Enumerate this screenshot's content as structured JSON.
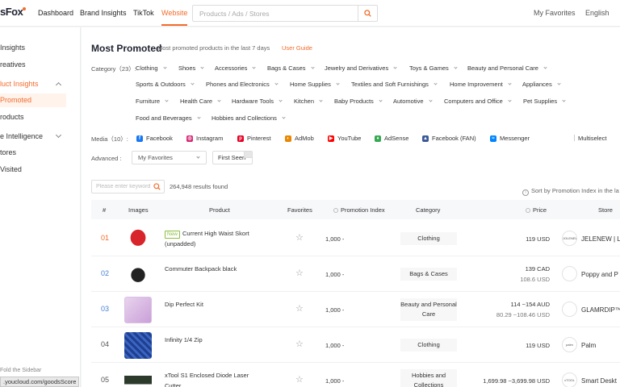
{
  "topnav": {
    "logo": "sFox",
    "items": [
      "Dashboard",
      "Brand Insights",
      "TikTok",
      "Website"
    ],
    "active_index": 3,
    "search_placeholder": "Products / Ads / Stores",
    "favorites": "My Favorites",
    "language": "English"
  },
  "sidebar": {
    "items": [
      "Insights",
      "reatives",
      "luct Insights",
      "Promoted",
      "roducts",
      "e Intelligence",
      "tores",
      "Visited"
    ],
    "fold_label": "Fold the Sidebar",
    "status_url": ".youcloud.com/goodsScore"
  },
  "header": {
    "title": "Most Promoted",
    "subtitle": "Most promoted products in the last 7 days",
    "guide": "User Guide"
  },
  "filters": {
    "category_label": "Category（23）:",
    "categories": [
      "Clothing",
      "Shoes",
      "Accessories",
      "Bags & Cases",
      "Jewelry and Derivatives",
      "Toys & Games",
      "Beauty and Personal Care",
      "Sports & Outdoors",
      "Phones and Electronics",
      "Home Supplies",
      "Textiles and Soft Furnishings",
      "Home Improvement",
      "Appliances",
      "Furniture",
      "Health Care",
      "Hardware Tools",
      "Kitchen",
      "Baby Products",
      "Automotive",
      "Computers and Office",
      "Pet Supplies",
      "Food and Beverages",
      "Hobbies and Collections"
    ],
    "media_label": "Media（10）:",
    "media": [
      {
        "label": "Facebook",
        "icon": "facebook-icon",
        "color": "#1877f2",
        "glyph": "f"
      },
      {
        "label": "Instagram",
        "icon": "instagram-icon",
        "color": "#d62976",
        "glyph": "◎"
      },
      {
        "label": "Pinterest",
        "icon": "pinterest-icon",
        "color": "#e60023",
        "glyph": "p"
      },
      {
        "label": "AdMob",
        "icon": "admob-icon",
        "color": "#ea8600",
        "glyph": "◐"
      },
      {
        "label": "YouTube",
        "icon": "youtube-icon",
        "color": "#ff0000",
        "glyph": "▶"
      },
      {
        "label": "AdSense",
        "icon": "adsense-icon",
        "color": "#34a853",
        "glyph": "♦"
      },
      {
        "label": "Facebook (FAN)",
        "icon": "facebook-fan-icon",
        "color": "#3b5998",
        "glyph": "▲"
      },
      {
        "label": "Messenger",
        "icon": "messenger-icon",
        "color": "#0084ff",
        "glyph": "≈"
      }
    ],
    "multiselect": "Multiselect",
    "advanced_label": "Advanced :",
    "favorites_select": "My Favorites",
    "first_seen": "First Seen"
  },
  "results": {
    "keyword_placeholder": "Please enter keyword",
    "count_text": "264,948 results found",
    "sort_info": "Sort by Promotion Index in the la"
  },
  "table": {
    "headers": [
      "#",
      "Images",
      "Product",
      "Favorites",
      "Promotion Index",
      "Category",
      "Price",
      "Store"
    ],
    "rows": [
      {
        "rank": "01",
        "new": "New",
        "name": "Current High Waist Skort (unpadded)",
        "index": "1,000 -",
        "category": "Clothing",
        "price": "119 USD",
        "price_sub": "",
        "store_logo": "JOLENEW",
        "store": "JELENEW | L"
      },
      {
        "rank": "02",
        "new": "",
        "name": "Commuter Backpack black",
        "index": "1,000 -",
        "category": "Bags & Cases",
        "price": "139 CAD",
        "price_sub": "108.6 USD",
        "store_logo": "",
        "store": "Poppy and P"
      },
      {
        "rank": "03",
        "new": "",
        "name": "Dip Perfect Kit",
        "index": "1,000 -",
        "category": "Beauty and Personal Care",
        "price": "114 ~154 AUD",
        "price_sub": "80.29 ~108.46 USD",
        "store_logo": "",
        "store": "GLAMRDIP™"
      },
      {
        "rank": "04",
        "new": "",
        "name": "Infinity 1/4 Zip",
        "index": "1,000 -",
        "category": "Clothing",
        "price": "119 USD",
        "price_sub": "",
        "store_logo": "palm",
        "store": "Palm"
      },
      {
        "rank": "05",
        "new": "",
        "name": "xTool S1 Enclosed Diode Laser Cutter",
        "index": "1,000 -",
        "category": "Hobbies and Collections",
        "price": "1,699.98 ~3,699.98 USD",
        "price_sub": "",
        "store_logo": "xTOOL",
        "store": "Smart Deskt"
      }
    ]
  },
  "colors": {
    "accent": "#f26b2b",
    "link_blue": "#4a7fd6",
    "new_tag": "#8cbf3f"
  }
}
